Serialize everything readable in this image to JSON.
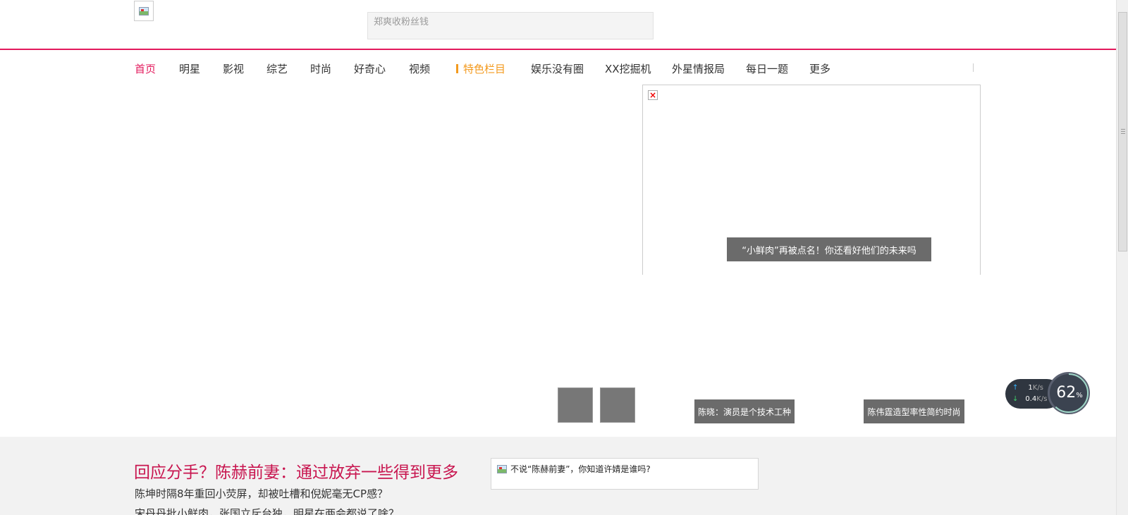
{
  "header": {
    "logo_icon": "broken-image-icon",
    "search_placeholder": "郑爽收粉丝钱"
  },
  "nav": {
    "items": [
      "首页",
      "明星",
      "影视",
      "综艺",
      "时尚",
      "好奇心",
      "视频"
    ],
    "special": "特色栏目",
    "columns": [
      "娱乐没有圈",
      "XX挖掘机",
      "外星情报局",
      "每日一题",
      "更多"
    ]
  },
  "slider": {
    "main_caption": "“小鲜肉”再被点名！你还看好他们的未来吗",
    "caption_2": "陈晓：演员是个技术工种",
    "caption_3": "陈伟霆造型率性简约时尚"
  },
  "feature": {
    "headline": "回应分手？陈赫前妻：通过放弃一些得到更多",
    "sub1": "陈坤时隔8年重回小荧屏，却被吐槽和倪妮毫无CP感？",
    "sub2": "宋丹丹批小鲜肉，张国立斥台独，明星在两会都说了啥？",
    "side_text": "不说“陈赫前妻”，你知道许婧是谁吗?"
  },
  "speed_widget": {
    "up": "1",
    "up_unit": "K/s",
    "down": "0.4",
    "down_unit": "K/s",
    "percent": "62",
    "percent_unit": "%",
    "percent_value": 0.62
  },
  "colors": {
    "brand": "#e3195c",
    "special": "#f39a1e"
  }
}
